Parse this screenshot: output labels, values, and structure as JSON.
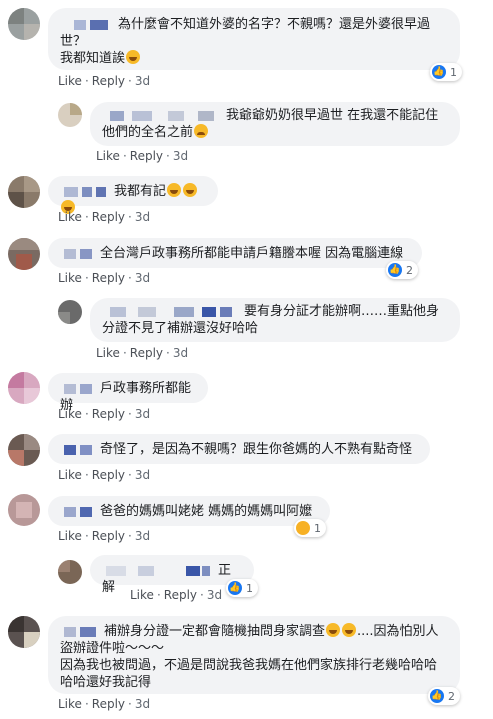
{
  "actions": {
    "like": "Like",
    "reply": "Reply",
    "sep": "·"
  },
  "comments": [
    {
      "text": "為什麼會不知道外婆的名字？不親嗎？還是外婆很早過世？\n我都知道誒",
      "time": "3d",
      "reactions": "1"
    },
    {
      "text": "我爺爺奶奶很早過世 在我還不能記住他們的全名之前",
      "time": "3d"
    },
    {
      "text": "我都有記",
      "time": "3d"
    },
    {
      "text": "全台灣戶政事務所都能申請戶籍謄本喔 因為電腦連線",
      "time": "3d",
      "reactions": "2"
    },
    {
      "text": "要有身分証才能辦啊……重點他身分證不見了補辦還沒好哈哈",
      "time": "3d"
    },
    {
      "text": "戶政事務所都能辦",
      "time": "3d"
    },
    {
      "text": "奇怪了，是因為不親嗎？跟生你爸媽的人不熟有點奇怪",
      "time": "3d"
    },
    {
      "text": "爸爸的媽媽叫姥姥 媽媽的媽媽叫阿嬤",
      "time": "3d",
      "reactions": "1"
    },
    {
      "text": "正解",
      "time": "3d",
      "reactions": "1"
    },
    {
      "text": "補辦身分證一定都會隨機抽問身家調查",
      "text2": "....因為怕別人盜辦證件啦～～～",
      "text3": "因為我也被問過，不過是問說我爸我媽在他們家族排行老幾哈哈哈哈哈還好我記得",
      "time": "3d",
      "reactions": "2"
    }
  ]
}
